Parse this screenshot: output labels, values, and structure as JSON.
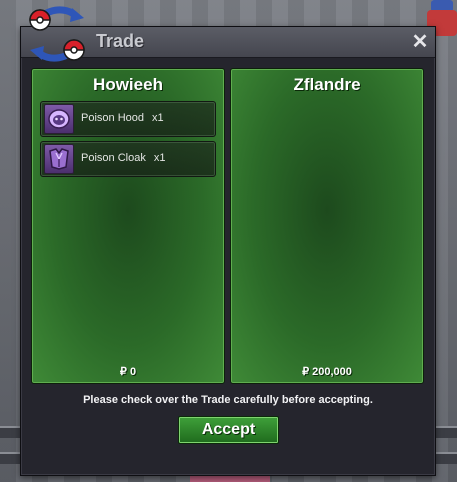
{
  "window": {
    "title": "Trade",
    "close_icon": "close-icon",
    "logo_icon": "pokeball-swap-logo"
  },
  "left_panel": {
    "player_name": "Howieeh",
    "money": "₽ 0",
    "items": [
      {
        "name": "Poison Hood",
        "qty": "x1",
        "icon": "poison-hood-icon"
      },
      {
        "name": "Poison Cloak",
        "qty": "x1",
        "icon": "poison-cloak-icon"
      }
    ]
  },
  "right_panel": {
    "player_name": "Zflandre",
    "money": "₽ 200,000",
    "items": []
  },
  "footer": {
    "notice": "Please check over the Trade carefully before accepting.",
    "accept_label": "Accept"
  },
  "colors": {
    "panel_green": "#2b6a28",
    "accept_green": "#3fa03a",
    "window_bg": "#25252d"
  }
}
